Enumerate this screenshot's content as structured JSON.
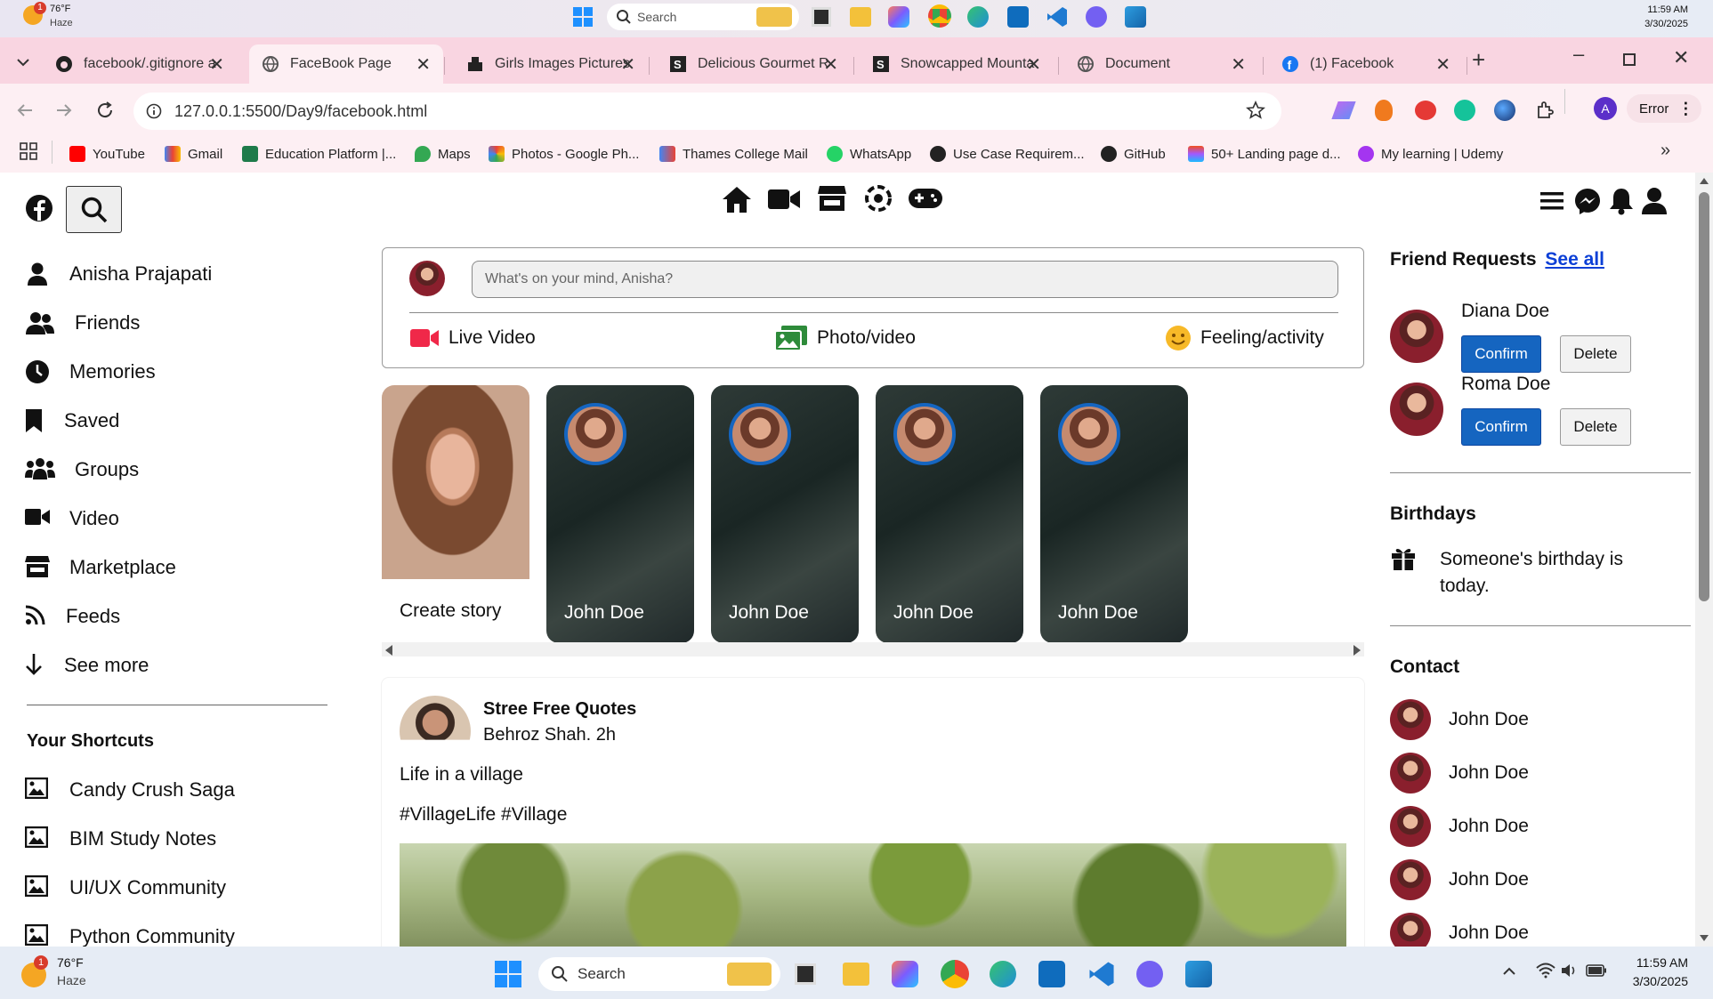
{
  "taskbar_top": {
    "weather_temp": "76°F",
    "weather_desc": "Haze",
    "weather_badge": "1",
    "search_placeholder": "Search",
    "time": "11:59 AM",
    "date": "3/30/2025"
  },
  "browser": {
    "tabs": [
      {
        "label": "facebook/.gitignore a",
        "icon": "github-icon"
      },
      {
        "label": "FaceBook Page",
        "icon": "globe-icon",
        "active": true
      },
      {
        "label": "Girls Images Pictures",
        "icon": "unsplash-icon"
      },
      {
        "label": "Delicious Gourmet R",
        "icon": "s-icon"
      },
      {
        "label": "Snowcapped Mounta",
        "icon": "s-icon"
      },
      {
        "label": "Document",
        "icon": "globe-icon"
      },
      {
        "label": "(1) Facebook",
        "icon": "facebook-icon"
      }
    ],
    "url": "127.0.0.1:5500/Day9/facebook.html",
    "profile_initial": "A",
    "error_label": "Error",
    "bookmarks": [
      "YouTube",
      "Gmail",
      "Education Platform |...",
      "Maps",
      "Photos - Google Ph...",
      "Thames College Mail",
      "WhatsApp",
      "Use Case Requirem...",
      "GitHub",
      "50+ Landing page d...",
      "My learning | Udemy"
    ]
  },
  "sidebar": {
    "items": [
      {
        "label": "Anisha Prajapati",
        "icon": "user-icon"
      },
      {
        "label": "Friends",
        "icon": "friends-icon"
      },
      {
        "label": "Memories",
        "icon": "clock-icon"
      },
      {
        "label": "Saved",
        "icon": "bookmark-icon"
      },
      {
        "label": "Groups",
        "icon": "groups-icon"
      },
      {
        "label": "Video",
        "icon": "video-icon"
      },
      {
        "label": "Marketplace",
        "icon": "store-icon"
      },
      {
        "label": "Feeds",
        "icon": "rss-icon"
      },
      {
        "label": "See more",
        "icon": "arrow-down-icon"
      }
    ],
    "shortcuts_title": "Your Shortcuts",
    "shortcuts": [
      "Candy Crush Saga",
      "BIM Study Notes",
      "UI/UX Community",
      "Python Community"
    ]
  },
  "composer": {
    "placeholder": "What's on your mind, Anisha?",
    "actions": [
      "Live Video",
      "Photo/video",
      "Feeling/activity"
    ]
  },
  "stories": {
    "create_label": "Create story",
    "names": [
      "John Doe",
      "John Doe",
      "John Doe",
      "John Doe"
    ]
  },
  "post": {
    "page_name": "Stree Free Quotes",
    "meta": "Behroz Shah. 2h",
    "text": "Life in a village",
    "tags": "#VillageLife #Village"
  },
  "right": {
    "friend_requests_title": "Friend Requests",
    "see_all": "See all",
    "requests": [
      {
        "name": "Diana Doe",
        "confirm": "Confirm",
        "delete": "Delete"
      },
      {
        "name": "Roma Doe",
        "confirm": "Confirm",
        "delete": "Delete"
      }
    ],
    "birthdays_title": "Birthdays",
    "birthday_text": "Someone's birthday is today.",
    "contact_title": "Contact",
    "contacts": [
      "John Doe",
      "John Doe",
      "John Doe",
      "John Doe",
      "John Doe"
    ]
  },
  "taskbar_bottom": {
    "weather_temp": "76°F",
    "weather_desc": "Haze",
    "weather_badge": "1",
    "search_label": "Search",
    "time": "11:59 AM",
    "date": "3/30/2025"
  },
  "colors": {
    "accent_blue": "#1565c0",
    "tab_strip": "#f9d5e1",
    "toolbar": "#fdeff3"
  }
}
